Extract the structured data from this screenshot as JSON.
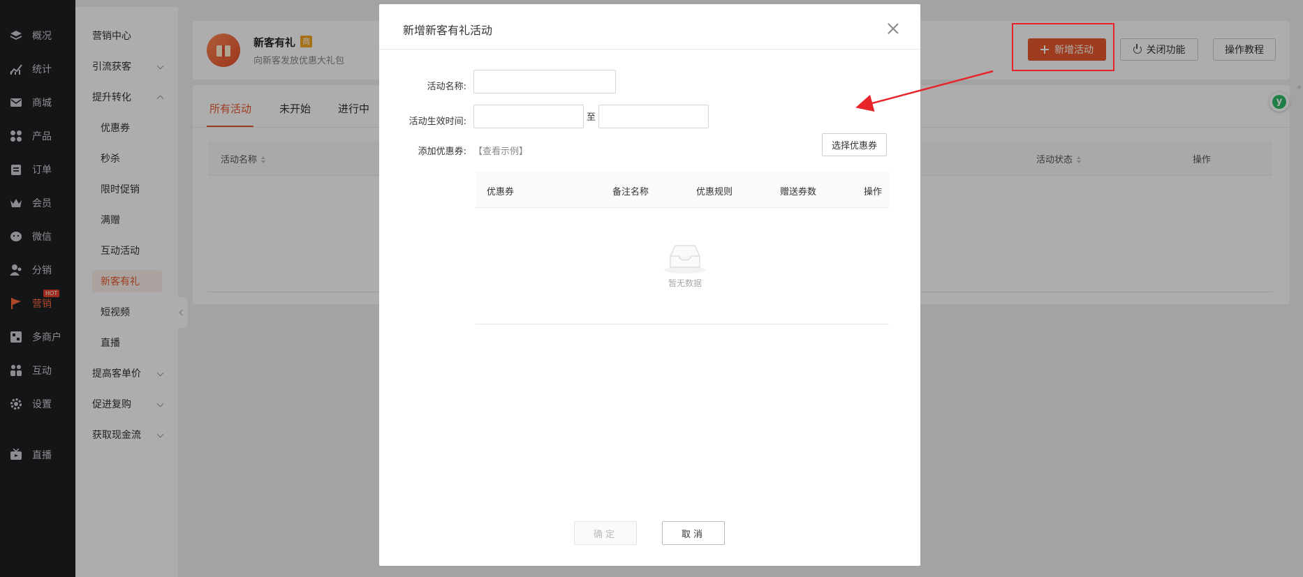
{
  "nav": {
    "items": [
      {
        "label": "概况",
        "icon": "layers-icon"
      },
      {
        "label": "统计",
        "icon": "chart-icon"
      },
      {
        "label": "商城",
        "icon": "mail-icon"
      },
      {
        "label": "产品",
        "icon": "grid-icon"
      },
      {
        "label": "订单",
        "icon": "clipboard-icon"
      },
      {
        "label": "会员",
        "icon": "crown-icon"
      },
      {
        "label": "微信",
        "icon": "wechat-icon"
      },
      {
        "label": "分销",
        "icon": "users-icon"
      },
      {
        "label": "营销",
        "icon": "flag-icon",
        "badge": "HOT"
      },
      {
        "label": "多商户",
        "icon": "store-icon"
      },
      {
        "label": "互动",
        "icon": "people-icon"
      },
      {
        "label": "设置",
        "icon": "gear-icon"
      },
      {
        "label": "直播",
        "icon": "tv-icon"
      }
    ],
    "active_color": "#ff6a3d"
  },
  "subnav": {
    "items": [
      {
        "label": "营销中心"
      },
      {
        "label": "引流获客"
      },
      {
        "label": "提升转化"
      },
      {
        "label": "优惠券"
      },
      {
        "label": "秒杀"
      },
      {
        "label": "限时促销"
      },
      {
        "label": "满赠"
      },
      {
        "label": "互动活动"
      },
      {
        "label": "新客有礼"
      },
      {
        "label": "短视频"
      },
      {
        "label": "直播"
      },
      {
        "label": "提高客单价"
      },
      {
        "label": "促进复购"
      },
      {
        "label": "获取现金流"
      }
    ]
  },
  "header": {
    "title": "新客有礼",
    "badge": "商",
    "subtitle": "向新客发放优惠大礼包",
    "new_activity_label": "新增活动",
    "close_feature_label": "关闭功能",
    "tutorial_label": "操作教程"
  },
  "tabs": [
    {
      "label": "所有活动"
    },
    {
      "label": "未开始"
    },
    {
      "label": "进行中"
    }
  ],
  "table": {
    "columns": [
      {
        "label": "活动名称"
      },
      {
        "label": "活动状态"
      },
      {
        "label": "操作"
      }
    ]
  },
  "modal": {
    "title": "新增新客有礼活动",
    "name_label": "活动名称:",
    "time_label": "活动生效时间:",
    "time_separator": "至",
    "coupon_label": "添加优惠券:",
    "example_link": "【查看示例】",
    "select_coupon_label": "选择优惠券",
    "coupon_table": {
      "columns": [
        {
          "label": "优惠券"
        },
        {
          "label": "备注名称"
        },
        {
          "label": "优惠规则"
        },
        {
          "label": "赠送券数"
        },
        {
          "label": "操作"
        }
      ],
      "empty_text": "暂无数据"
    },
    "confirm_label": "确定",
    "cancel_label": "取消"
  },
  "colors": {
    "brand": "#e9592f",
    "annotation": "#e8232a",
    "sidebar_bg": "#1e1f23"
  }
}
